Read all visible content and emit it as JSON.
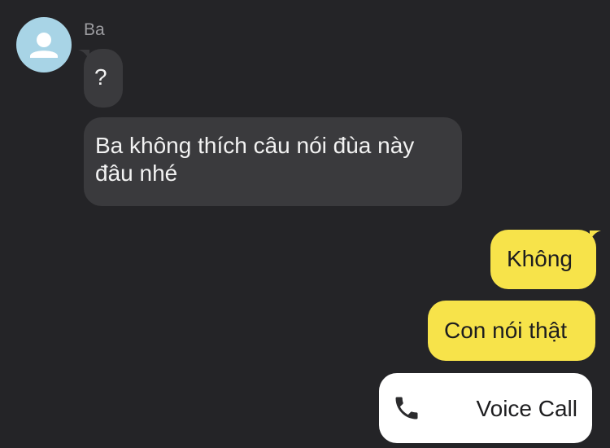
{
  "contact": {
    "name": "Ba",
    "avatar_icon": "default-user-avatar-icon"
  },
  "messages": [
    {
      "direction": "incoming",
      "text": "?"
    },
    {
      "direction": "incoming",
      "text": "Ba không thích câu nói đùa này đâu nhé"
    },
    {
      "direction": "outgoing",
      "text": "Không"
    },
    {
      "direction": "outgoing",
      "text": "Con nói thật"
    }
  ],
  "voice_call": {
    "icon": "phone-icon",
    "label": "Voice Call"
  },
  "colors": {
    "background": "#242427",
    "incoming_bubble": "#3a3a3d",
    "outgoing_bubble": "#f7e34a",
    "avatar": "#a8d4e6",
    "call_card": "#ffffff"
  }
}
